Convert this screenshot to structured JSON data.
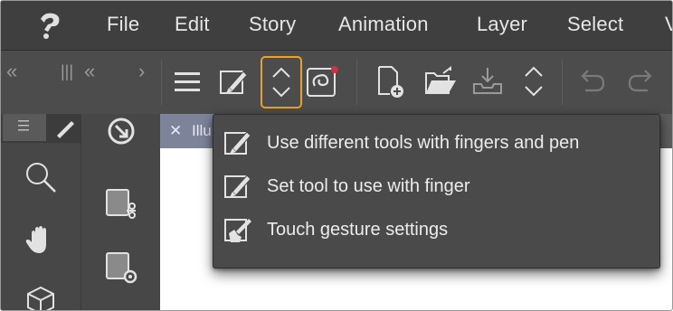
{
  "menubar": {
    "items": [
      {
        "label": "File"
      },
      {
        "label": "Edit"
      },
      {
        "label": "Story"
      },
      {
        "label": "Animation"
      },
      {
        "label": "Layer"
      },
      {
        "label": "Select"
      },
      {
        "label": "V"
      }
    ]
  },
  "panel_controls": {
    "collapse_left": "«",
    "grip": "|||",
    "collapse_left_2": "«",
    "expand_right": "›"
  },
  "toolbar": {
    "buttons": [
      {
        "icon": "hamburger-menu-icon"
      },
      {
        "icon": "pen-finger-tool-icon"
      },
      {
        "icon": "up-down-chevron-icon",
        "selected": true
      },
      {
        "icon": "companion-link-icon"
      },
      {
        "icon": "new-file-icon"
      },
      {
        "icon": "open-folder-icon"
      },
      {
        "icon": "save-icon"
      },
      {
        "icon": "up-down-chevron-icon"
      },
      {
        "icon": "undo-icon"
      },
      {
        "icon": "redo-icon"
      }
    ],
    "selected_color": "#f0a020"
  },
  "left_panel": {
    "tab_icon": "list-icon",
    "tools": [
      "magnifier-icon",
      "hand-icon",
      "cube-icon"
    ]
  },
  "mid_panel": {
    "tools": [
      "rotate-view-icon",
      "layer-property-icon",
      "sub-tool-settings-icon"
    ]
  },
  "document": {
    "tab_close": "✕",
    "tab_title": "Illu"
  },
  "dropdown": {
    "items": [
      {
        "label": "Use different tools with fingers and pen",
        "icon": "pen-finger-icon"
      },
      {
        "label": "Set tool to use with finger",
        "icon": "finger-tool-icon"
      },
      {
        "label": "Touch gesture settings",
        "icon": "touch-gesture-icon"
      }
    ]
  }
}
